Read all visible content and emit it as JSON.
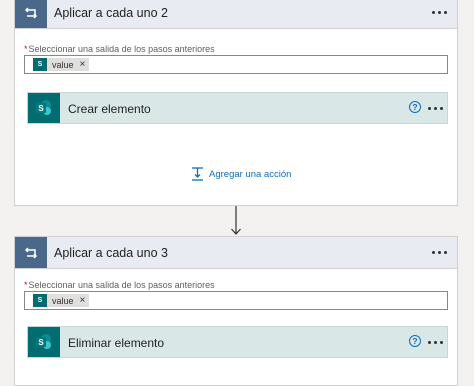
{
  "loops": [
    {
      "title": "Aplicar a cada uno 2",
      "field_label": "Seleccionar una salida de los pasos anteriores",
      "token": {
        "label": "value",
        "remove": "×"
      },
      "action": {
        "title": "Crear elemento",
        "help": "?"
      },
      "add_action_label": "Agregar una acción"
    },
    {
      "title": "Aplicar a cada uno 3",
      "field_label": "Seleccionar una salida de los pasos anteriores",
      "token": {
        "label": "value",
        "remove": "×"
      },
      "action": {
        "title": "Eliminar elemento",
        "help": "?"
      }
    }
  ],
  "icons": {
    "loop": "loop-icon",
    "sharepoint": "sharepoint-icon",
    "more": "more-options-icon",
    "help": "help-icon",
    "add_action": "add-action-icon",
    "connector_arrow": "arrow-down-icon"
  },
  "colors": {
    "loop_header_bg": "#e8ebf1",
    "loop_icon_bg": "#4a6889",
    "sharepoint": "#036c70",
    "action_bg": "#d9e7e7",
    "link": "#0f6cbd"
  },
  "required_marker": "*"
}
